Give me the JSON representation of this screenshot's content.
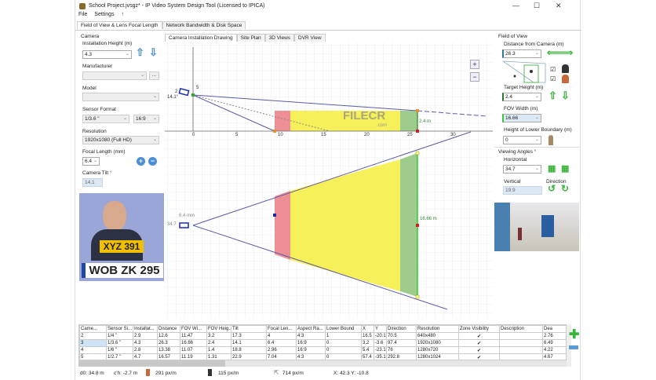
{
  "window": {
    "title": "School Project.jvsgz* - IP Video System Design Tool (Licensed to IPICA)",
    "minimize": "—",
    "maximize": "☐",
    "close": "✕"
  },
  "menu": [
    "File",
    "Settings",
    "↑"
  ],
  "main_tabs": [
    "Field of View & Lens Focal Length",
    "Network Bandwidth & Disk Space"
  ],
  "camera": {
    "group": "Camera",
    "height_label": "Installation Height (m)",
    "height": "4.3",
    "manufacturer_label": "Manufacturer",
    "manufacturer": "",
    "manufacturer_btn": "...",
    "model_label": "Model",
    "model": "",
    "sensor_label": "Sensor Format",
    "sensor": "1/3.6 \"",
    "aspect": "16:9",
    "resolution_label": "Resolution",
    "resolution": "1920x1080 (Full HD)",
    "focal_label": "Focal Length (mm)",
    "focal": "6.4",
    "tilt_label": "Camera Tilt °",
    "tilt": "14.1"
  },
  "preview": {
    "plate1": "XYZ 391",
    "plate2": "WOB ZK 295"
  },
  "drawing_tabs": [
    "Camera Installation Drawing",
    "Site Plan",
    "3D Views",
    "DVR View"
  ],
  "drawing": {
    "x_ticks": [
      "0",
      "5",
      "10",
      "15",
      "20",
      "25",
      "30"
    ],
    "cam_height_label": "5",
    "tilt_angle": "14.1°",
    "cam_num": "2",
    "target_height": "2.4 m",
    "focal_label": "6.4 mm",
    "h_angle": "34.7",
    "fov_width": "16.66 m",
    "watermark": "FILECR",
    "watermark_sub": ".com",
    "zoom_in": "+",
    "zoom_out": "−"
  },
  "fov": {
    "group": "Field of View",
    "distance_label": "Distance from Camera (m)",
    "distance": "26.3",
    "target_label": "Target Height (m)",
    "target": "2.4",
    "width_label": "FOV Width (m)",
    "width": "16.66",
    "lower_label": "Height of Lower Boundary (m)",
    "lower": "0",
    "angles_group": "Viewing Angles °",
    "horizontal_label": "Horizontal",
    "horizontal": "34.7",
    "vertical_label": "Vertical",
    "vertical": "19.9",
    "direction_label": "Direction"
  },
  "table": {
    "headers": [
      "Came...",
      "Sensor Si...",
      "Installat...",
      "Distance",
      "FOV Wi...",
      "FOV Heig...",
      "Tilt",
      "Focal Len...",
      "Aspect Ra...",
      "Lower Bound",
      "X",
      "Y",
      "Direction",
      "Resolution",
      "Zone Visibility",
      "Description",
      "Dea"
    ],
    "rows": [
      [
        "2",
        "1/4 \"",
        "2.9",
        "12.6",
        "11.47",
        "3.2",
        "17.3",
        "4",
        "4:3",
        "1",
        "16.5",
        "-20.1",
        "70.5",
        "640x480",
        "✔",
        "",
        "2.76"
      ],
      [
        "3",
        "1/3.6 \"",
        "4.3",
        "26.3",
        "16.66",
        "2.4",
        "14.1",
        "6.4",
        "16:9",
        "0",
        "3.2",
        "-3.6",
        "97.4",
        "1920x1080",
        "✔",
        "",
        "6.49"
      ],
      [
        "4",
        "1/6 \"",
        "2.8",
        "13.38",
        "11.07",
        "1.4",
        "18.8",
        "2.96",
        "16:9",
        "0",
        "5.4",
        "-23.1",
        "76",
        "1280x720",
        "✔",
        "",
        "4.22"
      ],
      [
        "5",
        "1/2.7 \"",
        "4.7",
        "16.57",
        "11.19",
        "1.31",
        "22.9",
        "7.04",
        "4:3",
        "0",
        "57.4",
        "-35.1",
        "292.8",
        "1280x1024",
        "✔",
        "",
        "4.67"
      ]
    ]
  },
  "status": {
    "dist": "d0: 34.8 m",
    "height": "c'h: -2.7 m",
    "ppm1": "291 px/m",
    "ppm2": "115 px/m",
    "ppm3": "714 px/m",
    "coords": "X: 42.3 Y: -10.8"
  }
}
